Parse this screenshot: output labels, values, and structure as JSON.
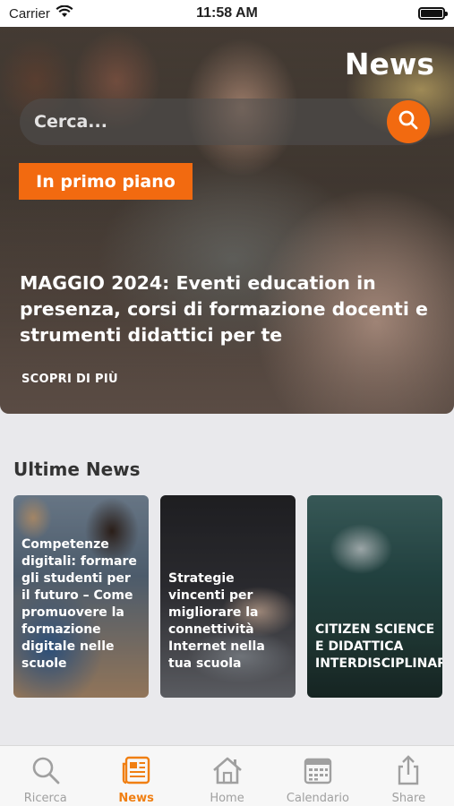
{
  "status_bar": {
    "carrier": "Carrier",
    "time": "11:58 AM"
  },
  "header": {
    "title": "News"
  },
  "search": {
    "placeholder": "Cerca..."
  },
  "featured": {
    "badge": "In primo piano",
    "headline": "MAGGIO 2024: Eventi education in presenza, corsi di formazione docenti e strumenti didattici per te",
    "link": "SCOPRI DI PIÙ"
  },
  "latest": {
    "title": "Ultime News",
    "cards": [
      {
        "title": "Competenze digitali: formare gli studenti per il futuro – Come promuovere la formazione digitale nelle scuole"
      },
      {
        "title": "Strategie vincenti per migliorare la connettività Internet nella tua scuola"
      },
      {
        "title": "CITIZEN SCIENCE E DIDATTICA INTERDISCIPLINARE"
      }
    ]
  },
  "tabs": [
    {
      "label": "Ricerca",
      "icon": "search-icon",
      "active": false
    },
    {
      "label": "News",
      "icon": "news-icon",
      "active": true
    },
    {
      "label": "Home",
      "icon": "home-icon",
      "active": false
    },
    {
      "label": "Calendario",
      "icon": "calendar-icon",
      "active": false
    },
    {
      "label": "Share",
      "icon": "share-icon",
      "active": false
    }
  ],
  "colors": {
    "accent": "#f26a10",
    "tab_active": "#f07f12",
    "tab_inactive": "#a0a0a0"
  }
}
